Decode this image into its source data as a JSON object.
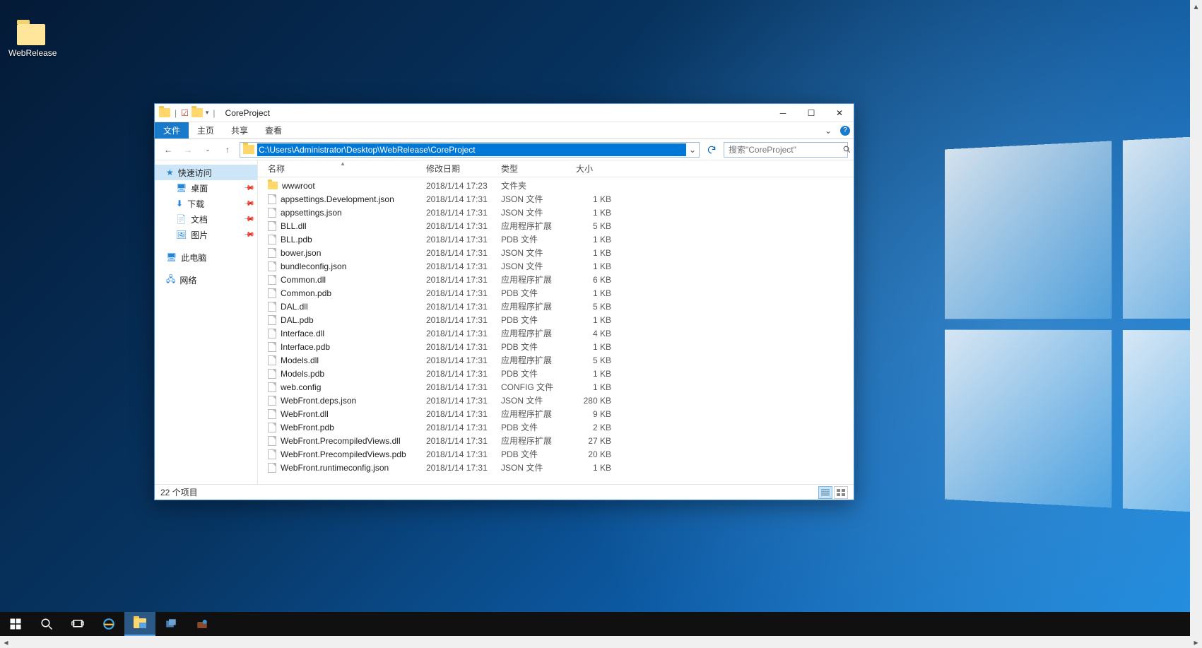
{
  "desktop": {
    "icon_label": "WebRelease"
  },
  "window": {
    "title": "CoreProject",
    "ribbon": {
      "file": "文件",
      "home": "主页",
      "share": "共享",
      "view": "查看"
    },
    "nav": {
      "path": "C:\\Users\\Administrator\\Desktop\\WebRelease\\CoreProject",
      "search_placeholder": "搜索\"CoreProject\""
    },
    "side": {
      "quick": "快速访问",
      "desktop": "桌面",
      "downloads": "下载",
      "documents": "文档",
      "pictures": "图片",
      "thispc": "此电脑",
      "network": "网络"
    },
    "columns": {
      "name": "名称",
      "date": "修改日期",
      "type": "类型",
      "size": "大小"
    },
    "files": [
      {
        "icon": "folder",
        "name": "wwwroot",
        "date": "2018/1/14 17:23",
        "type": "文件夹",
        "size": ""
      },
      {
        "icon": "file",
        "name": "appsettings.Development.json",
        "date": "2018/1/14 17:31",
        "type": "JSON 文件",
        "size": "1 KB"
      },
      {
        "icon": "file",
        "name": "appsettings.json",
        "date": "2018/1/14 17:31",
        "type": "JSON 文件",
        "size": "1 KB"
      },
      {
        "icon": "file",
        "name": "BLL.dll",
        "date": "2018/1/14 17:31",
        "type": "应用程序扩展",
        "size": "5 KB"
      },
      {
        "icon": "file",
        "name": "BLL.pdb",
        "date": "2018/1/14 17:31",
        "type": "PDB 文件",
        "size": "1 KB"
      },
      {
        "icon": "file",
        "name": "bower.json",
        "date": "2018/1/14 17:31",
        "type": "JSON 文件",
        "size": "1 KB"
      },
      {
        "icon": "file",
        "name": "bundleconfig.json",
        "date": "2018/1/14 17:31",
        "type": "JSON 文件",
        "size": "1 KB"
      },
      {
        "icon": "file",
        "name": "Common.dll",
        "date": "2018/1/14 17:31",
        "type": "应用程序扩展",
        "size": "6 KB"
      },
      {
        "icon": "file",
        "name": "Common.pdb",
        "date": "2018/1/14 17:31",
        "type": "PDB 文件",
        "size": "1 KB"
      },
      {
        "icon": "file",
        "name": "DAL.dll",
        "date": "2018/1/14 17:31",
        "type": "应用程序扩展",
        "size": "5 KB"
      },
      {
        "icon": "file",
        "name": "DAL.pdb",
        "date": "2018/1/14 17:31",
        "type": "PDB 文件",
        "size": "1 KB"
      },
      {
        "icon": "file",
        "name": "Interface.dll",
        "date": "2018/1/14 17:31",
        "type": "应用程序扩展",
        "size": "4 KB"
      },
      {
        "icon": "file",
        "name": "Interface.pdb",
        "date": "2018/1/14 17:31",
        "type": "PDB 文件",
        "size": "1 KB"
      },
      {
        "icon": "file",
        "name": "Models.dll",
        "date": "2018/1/14 17:31",
        "type": "应用程序扩展",
        "size": "5 KB"
      },
      {
        "icon": "file",
        "name": "Models.pdb",
        "date": "2018/1/14 17:31",
        "type": "PDB 文件",
        "size": "1 KB"
      },
      {
        "icon": "file",
        "name": "web.config",
        "date": "2018/1/14 17:31",
        "type": "CONFIG 文件",
        "size": "1 KB"
      },
      {
        "icon": "file",
        "name": "WebFront.deps.json",
        "date": "2018/1/14 17:31",
        "type": "JSON 文件",
        "size": "280 KB"
      },
      {
        "icon": "file",
        "name": "WebFront.dll",
        "date": "2018/1/14 17:31",
        "type": "应用程序扩展",
        "size": "9 KB"
      },
      {
        "icon": "file",
        "name": "WebFront.pdb",
        "date": "2018/1/14 17:31",
        "type": "PDB 文件",
        "size": "2 KB"
      },
      {
        "icon": "file",
        "name": "WebFront.PrecompiledViews.dll",
        "date": "2018/1/14 17:31",
        "type": "应用程序扩展",
        "size": "27 KB"
      },
      {
        "icon": "file",
        "name": "WebFront.PrecompiledViews.pdb",
        "date": "2018/1/14 17:31",
        "type": "PDB 文件",
        "size": "20 KB"
      },
      {
        "icon": "file",
        "name": "WebFront.runtimeconfig.json",
        "date": "2018/1/14 17:31",
        "type": "JSON 文件",
        "size": "1 KB"
      }
    ],
    "status": "22 个项目"
  }
}
